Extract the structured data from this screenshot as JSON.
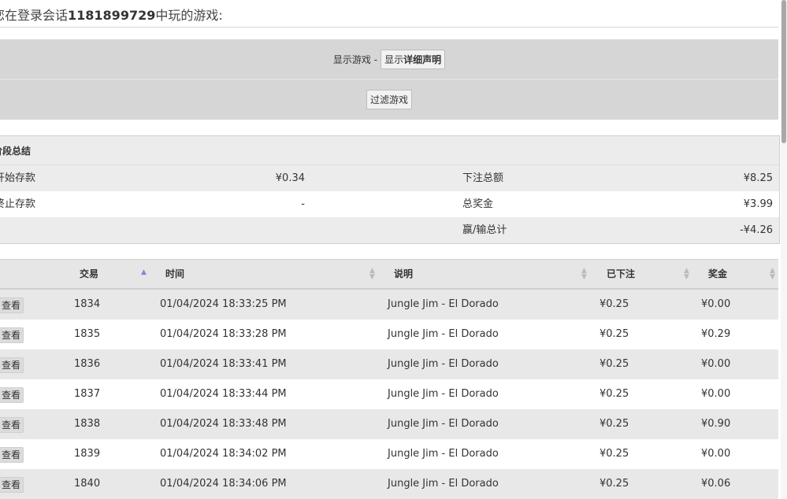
{
  "header": {
    "prefix": "您在登录会话",
    "session_id": "1181899729",
    "suffix": "中玩的游戏:"
  },
  "filters": {
    "label": "显示游戏 -",
    "show_details_normal": "显示",
    "show_details_bold": "详细声明",
    "filter_button": "过滤游戏"
  },
  "summary": {
    "title": "阶段总结",
    "rows": [
      {
        "label1": "开始存款",
        "value1": "¥0.34",
        "label2": "下注总额",
        "value2": "¥8.25"
      },
      {
        "label1": "终止存款",
        "value1": "-",
        "label2": "总奖金",
        "value2": "¥3.99"
      },
      {
        "label1": "",
        "value1": "",
        "label2": "赢/输总计",
        "value2": "-¥4.26"
      }
    ]
  },
  "table": {
    "columns": {
      "transaction": "交易",
      "time": "时间",
      "description": "说明",
      "bet": "已下注",
      "win": "奖金"
    },
    "view_label": "查看",
    "rows": [
      {
        "id": "1834",
        "time": "01/04/2024 18:33:25 PM",
        "desc": "Jungle Jim - El Dorado",
        "bet": "¥0.25",
        "win": "¥0.00"
      },
      {
        "id": "1835",
        "time": "01/04/2024 18:33:28 PM",
        "desc": "Jungle Jim - El Dorado",
        "bet": "¥0.25",
        "win": "¥0.29"
      },
      {
        "id": "1836",
        "time": "01/04/2024 18:33:41 PM",
        "desc": "Jungle Jim - El Dorado",
        "bet": "¥0.25",
        "win": "¥0.00"
      },
      {
        "id": "1837",
        "time": "01/04/2024 18:33:44 PM",
        "desc": "Jungle Jim - El Dorado",
        "bet": "¥0.25",
        "win": "¥0.00"
      },
      {
        "id": "1838",
        "time": "01/04/2024 18:33:48 PM",
        "desc": "Jungle Jim - El Dorado",
        "bet": "¥0.25",
        "win": "¥0.90"
      },
      {
        "id": "1839",
        "time": "01/04/2024 18:34:02 PM",
        "desc": "Jungle Jim - El Dorado",
        "bet": "¥0.25",
        "win": "¥0.00"
      },
      {
        "id": "1840",
        "time": "01/04/2024 18:34:06 PM",
        "desc": "Jungle Jim - El Dorado",
        "bet": "¥0.25",
        "win": "¥0.06"
      }
    ]
  },
  "icons": {
    "sort_asc": "sort-ascending-icon",
    "sort_both": "sort-both-icon"
  },
  "colors": {
    "sort_active": "#7b86e0",
    "panel_bg": "#d6d6d6"
  }
}
